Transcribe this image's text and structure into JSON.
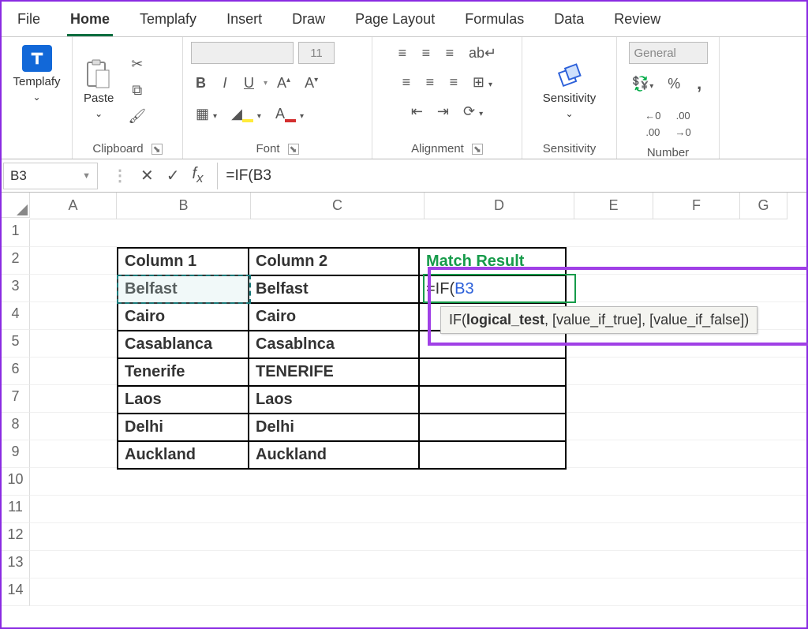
{
  "tabs": [
    "File",
    "Home",
    "Templafy",
    "Insert",
    "Draw",
    "Page Layout",
    "Formulas",
    "Data",
    "Review"
  ],
  "active_tab_index": 1,
  "ribbon": {
    "templafy": {
      "label": "Templafy",
      "group_label": ""
    },
    "clipboard": {
      "paste": "Paste",
      "group_label": "Clipboard"
    },
    "font": {
      "font_name_placeholder": "",
      "font_size": "11",
      "bold": "B",
      "italic": "I",
      "underline": "U",
      "group_label": "Font"
    },
    "alignment": {
      "wrap": "ab",
      "group_label": "Alignment"
    },
    "sensitivity": {
      "label": "Sensitivity",
      "group_label": "Sensitivity"
    },
    "number": {
      "format": "General",
      "group_label": "Number"
    }
  },
  "namebox": "B3",
  "formula_bar": "=IF(B3",
  "columns": [
    "A",
    "B",
    "C",
    "D",
    "E",
    "F",
    "G"
  ],
  "row_numbers": [
    "1",
    "2",
    "3",
    "4",
    "5",
    "6",
    "7",
    "8",
    "9",
    "10",
    "11",
    "12",
    "13",
    "14"
  ],
  "table": {
    "headers": [
      "Column 1",
      "Column 2",
      "Match Result"
    ],
    "rows": [
      [
        "Belfast",
        "Belfast",
        ""
      ],
      [
        "Cairo",
        "Cairo",
        ""
      ],
      [
        "Casablanca",
        "Casablnca",
        ""
      ],
      [
        "Tenerife",
        "TENERIFE",
        ""
      ],
      [
        "Laos",
        "Laos",
        ""
      ],
      [
        "Delhi",
        "Delhi",
        ""
      ],
      [
        "Auckland",
        "Auckland",
        ""
      ]
    ]
  },
  "editing_cell": {
    "prefix": "=IF(",
    "ref": "B3"
  },
  "tooltip": {
    "fn": "IF(",
    "arg1": "logical_test",
    "rest": ", [value_if_true], [value_if_false])"
  }
}
